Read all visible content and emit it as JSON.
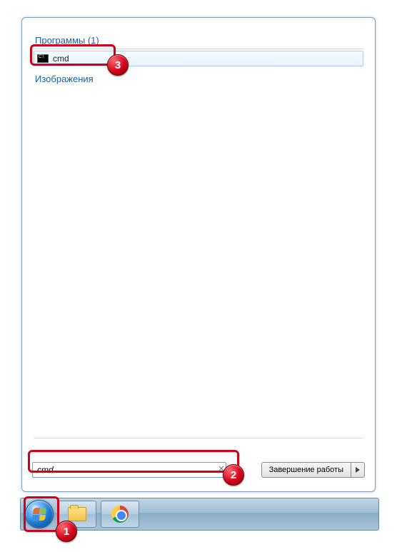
{
  "results": {
    "programs_header": "Программы (1)",
    "images_header": "Изображения",
    "items": [
      {
        "label": "cmd"
      }
    ]
  },
  "search": {
    "value": "cmd"
  },
  "shutdown": {
    "label": "Завершение работы"
  },
  "annotations": {
    "b1": "1",
    "b2": "2",
    "b3": "3"
  }
}
